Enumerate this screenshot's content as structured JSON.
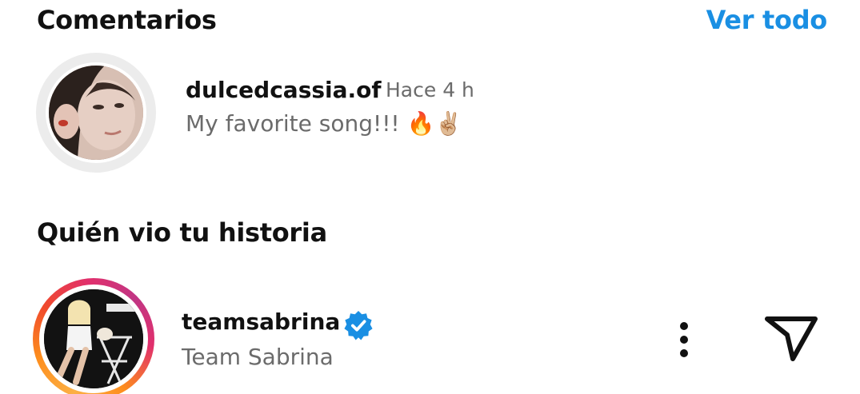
{
  "comments_section": {
    "title": "Comentarios",
    "see_all_label": "Ver todo",
    "comment": {
      "username": "dulcedcassia.of",
      "timestamp": "Hace 4 h",
      "text": "My favorite song!!! 🔥✌🏼",
      "avatar_icon": "user-photo"
    }
  },
  "viewers_section": {
    "title": "Quién vio tu historia",
    "viewer": {
      "username": "teamsabrina",
      "full_name": "Team Sabrina",
      "verified": true,
      "has_story_ring": true,
      "more_icon": "more-vertical-icon",
      "send_icon": "send-paper-plane-icon"
    }
  },
  "colors": {
    "accent": "#1a8fe3",
    "verified": "#1a8fe3",
    "secondary_text": "#6b6b6b",
    "primary_text": "#111111"
  }
}
